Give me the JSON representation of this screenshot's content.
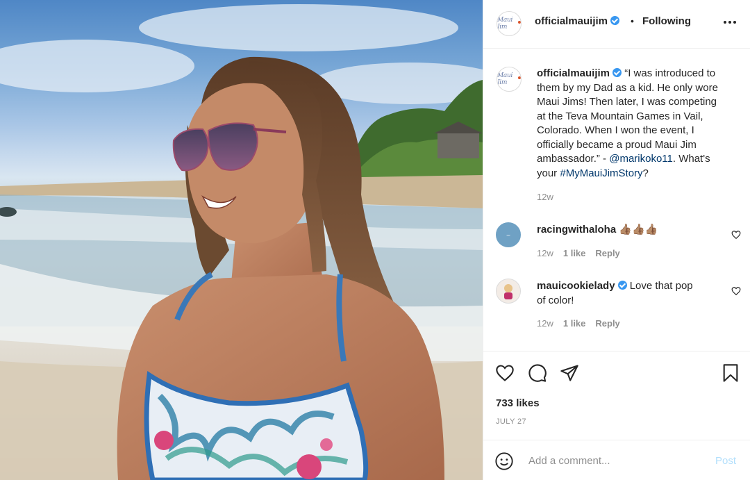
{
  "post": {
    "account": "officialmauijim",
    "follow_status": "Following",
    "separator": "•",
    "avatar_logo_text": "Maui Jim",
    "caption": {
      "line1": "“I was introduced to",
      "line2": "them by my Dad as a kid. He only wore",
      "line3": "Maui Jims! Then later, I was competing",
      "line4": "at the Teva Mountain Games in Vail,",
      "line5": "Colorado. When I won the event, I",
      "line6": "officially became a proud Maui Jim",
      "line7_prefix": "ambassador.” - ",
      "mention": "@marikoko11",
      "line7_suffix": ". What's",
      "line8_prefix": "your ",
      "hashtag": "#MyMauiJimStory",
      "line8_suffix": "?",
      "age": "12w"
    },
    "comments": [
      {
        "user": "racingwithaloha",
        "text": "👍🏽👍🏽👍🏽",
        "age": "12w",
        "likes": "1 like",
        "reply": "Reply"
      },
      {
        "user": "mauicookielady",
        "text": "Love that pop",
        "text2": "of color!",
        "age": "12w",
        "likes": "1 like",
        "reply": "Reply"
      }
    ],
    "likes": "733 likes",
    "date": "JULY 27",
    "comment_placeholder": "Add a comment...",
    "post_button": "Post"
  },
  "icons": {
    "more": "more-options-icon",
    "like": "heart-icon",
    "comment": "comment-bubble-icon",
    "share": "paper-plane-icon",
    "save": "bookmark-icon",
    "emoji": "emoji-smiley-icon"
  },
  "colors": {
    "verified": "#3897f0",
    "link": "#00376b",
    "muted": "#8e8e8e",
    "post_disabled": "#b2dffc"
  }
}
